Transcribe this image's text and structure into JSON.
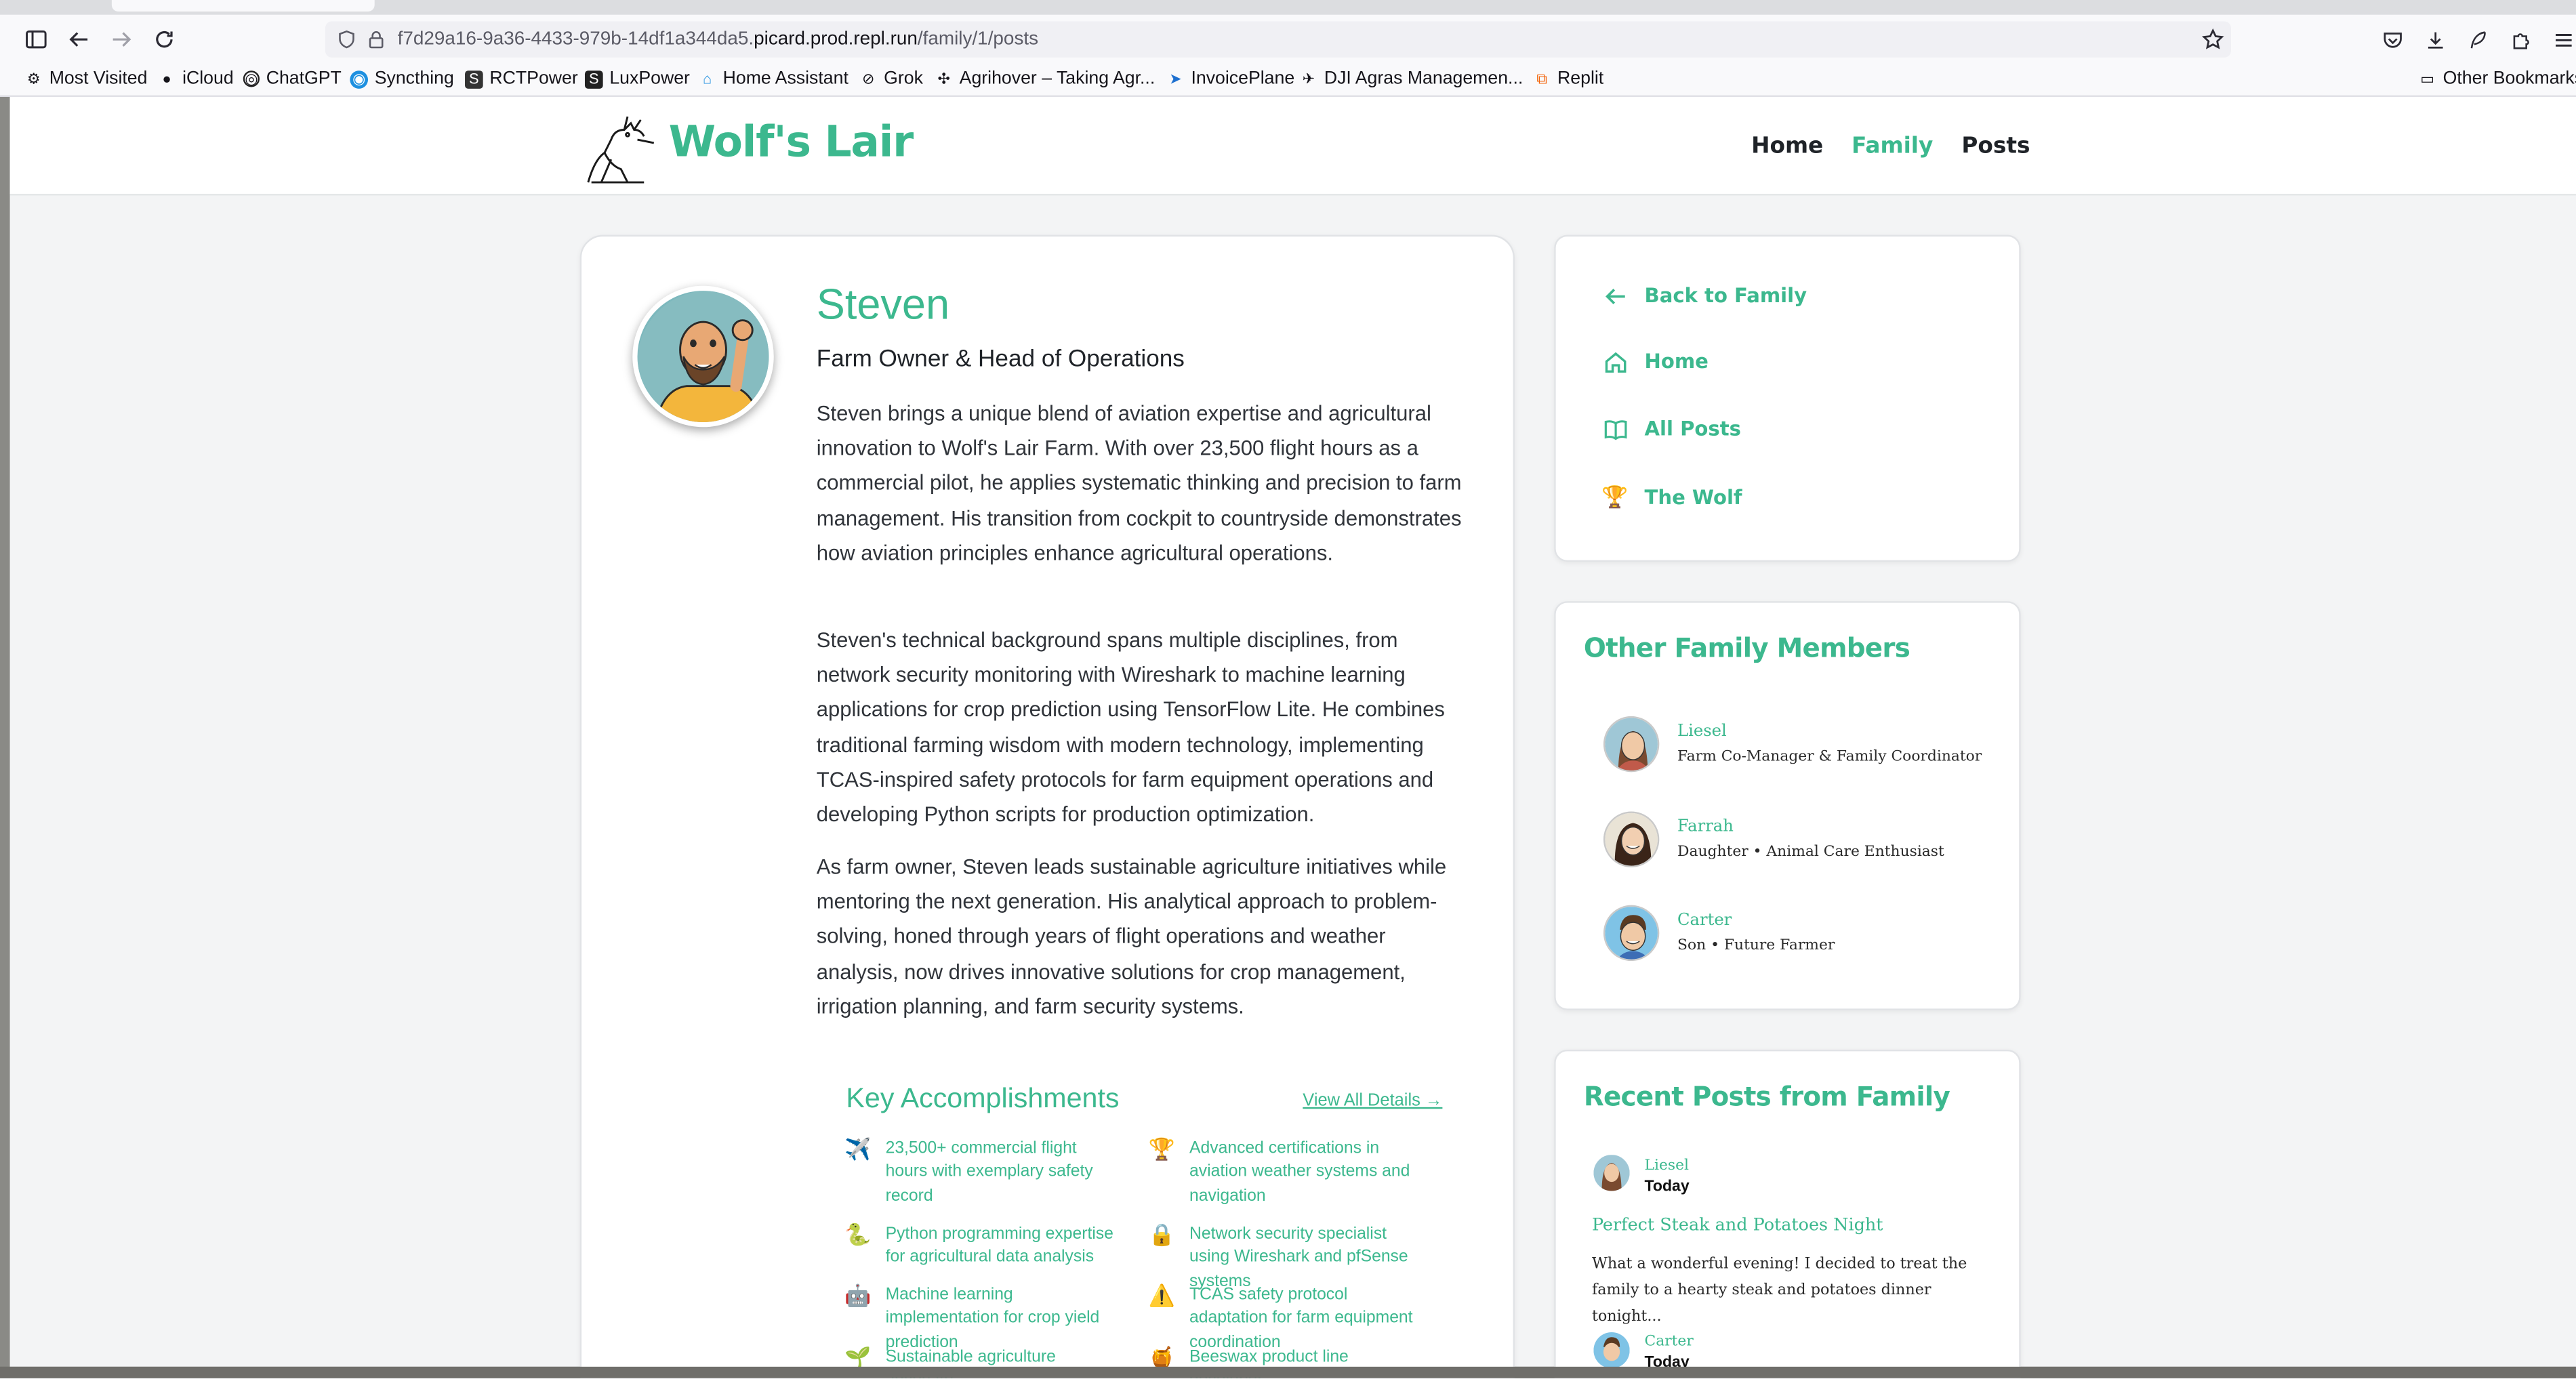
{
  "browser": {
    "url_prefix": "f7d29a16-9a36-4433-979b-14df1a344da5.",
    "url_domain": "picard.prod.repl.run",
    "url_path": "/family/1/posts",
    "bookmarks": [
      "Most Visited",
      "iCloud",
      "ChatGPT",
      "Syncthing",
      "RCTPower",
      "LuxPower",
      "Home Assistant",
      "Grok",
      "Agrihover – Taking Agr...",
      "InvoicePlane",
      "DJI Agras Managemen...",
      "Replit"
    ],
    "other_bookmarks": "Other Bookmarks"
  },
  "site": {
    "brand": "Wolf's Lair",
    "nav": [
      "Home",
      "Family",
      "Posts"
    ],
    "active_nav": "Family",
    "accent_color": "#3cb88e"
  },
  "profile": {
    "name": "Steven",
    "role": "Farm Owner & Head of Operations",
    "bio": [
      "Steven brings a unique blend of aviation expertise and agricultural innovation to Wolf's Lair Farm. With over 23,500 flight hours as a commercial pilot, he applies systematic thinking and precision to farm management. His transition from cockpit to countryside demonstrates how aviation principles enhance agricultural operations.",
      "Steven's technical background spans multiple disciplines, from network security monitoring with Wireshark to machine learning applications for crop prediction using TensorFlow Lite. He combines traditional farming wisdom with modern technology, implementing TCAS-inspired safety protocols for farm equipment operations and developing Python scripts for production optimization.",
      "As farm owner, Steven leads sustainable agriculture initiatives while mentoring the next generation. His analytical approach to problem-solving, honed through years of flight operations and weather analysis, now drives innovative solutions for crop management, irrigation planning, and farm security systems."
    ]
  },
  "accomplishments": {
    "title": "Key Accomplishments",
    "link": "View All Details →",
    "items": [
      {
        "icon": "✈️",
        "text": "23,500+ commercial flight hours with exemplary safety record"
      },
      {
        "icon": "🏆",
        "text": "Advanced certifications in aviation weather systems and navigation"
      },
      {
        "icon": "🐍",
        "text": "Python programming expertise for agricultural data analysis"
      },
      {
        "icon": "🔒",
        "text": "Network security specialist using Wireshark and pfSense systems"
      },
      {
        "icon": "🤖",
        "text": "Machine learning implementation for crop yield prediction"
      },
      {
        "icon": "⚠️",
        "text": "TCAS safety protocol adaptation for farm equipment coordination"
      },
      {
        "icon": "🌱",
        "text": "Sustainable agriculture advocate"
      },
      {
        "icon": "🍯",
        "text": "Beeswax product line developer"
      }
    ]
  },
  "sidebar": {
    "links": [
      {
        "label": "Back to Family",
        "icon": "arrow-left-icon"
      },
      {
        "label": "Home",
        "icon": "home-icon"
      },
      {
        "label": "All Posts",
        "icon": "book-icon"
      },
      {
        "label": "The Wolf",
        "icon": "trophy-icon"
      }
    ],
    "members_title": "Other Family Members",
    "members": [
      {
        "name": "Liesel",
        "role": "Farm Co-Manager & Family Coordinator"
      },
      {
        "name": "Farrah",
        "role": "Daughter • Animal Care Enthusiast"
      },
      {
        "name": "Carter",
        "role": "Son • Future Farmer"
      }
    ],
    "posts_title": "Recent Posts from Family",
    "posts": [
      {
        "author": "Liesel",
        "date": "Today",
        "title": "Perfect Steak and Potatoes Night",
        "excerpt": "What a wonderful evening! I decided to treat the family to a hearty steak and potatoes dinner tonight..."
      },
      {
        "author": "Carter",
        "date": "Today"
      }
    ]
  }
}
